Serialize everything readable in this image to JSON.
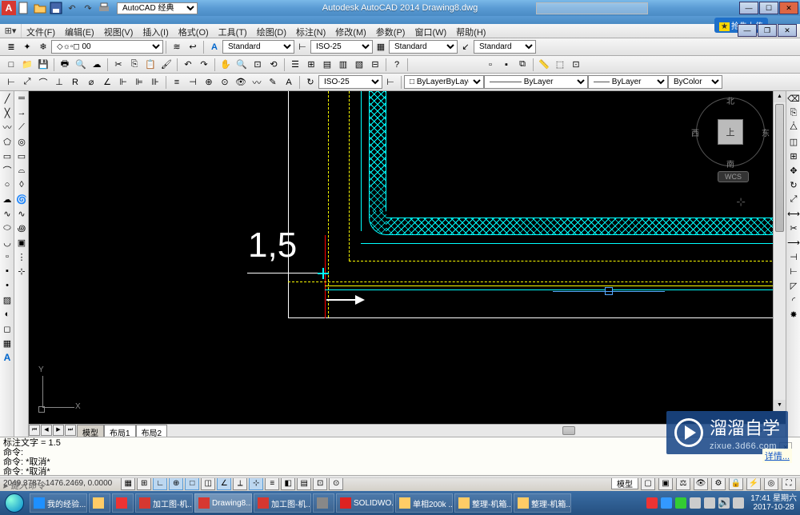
{
  "titlebar": {
    "workspace": "AutoCAD 经典",
    "app_title": "Autodesk AutoCAD 2014    Drawing8.dwg",
    "upload_btn": "抢先上传",
    "qat": {
      "new": "new-document-icon",
      "open": "open-folder-icon",
      "save": "save-disk-icon",
      "undo": "undo-icon",
      "redo": "redo-icon",
      "print": "print-icon"
    }
  },
  "menubar": {
    "items": [
      "文件(F)",
      "编辑(E)",
      "视图(V)",
      "插入(I)",
      "格式(O)",
      "工具(T)",
      "绘图(D)",
      "标注(N)",
      "修改(M)",
      "参数(P)",
      "窗口(W)",
      "帮助(H)"
    ]
  },
  "layer_toolbar": {
    "layer_combo": "0",
    "style1": "Standard",
    "dim_style": "ISO-25",
    "style2": "Standard",
    "style3": "Standard"
  },
  "properties_toolbar": {
    "annotative": "ISO-25",
    "color": "ByLayer",
    "linetype": "ByLayer",
    "lineweight": "ByLayer",
    "plotstyle": "ByColor"
  },
  "drawing": {
    "dim_text": "1,5",
    "axis_x": "X",
    "axis_y": "Y",
    "cube_face": "上",
    "cube_n": "北",
    "cube_s": "南",
    "cube_e": "东",
    "cube_w": "西",
    "wcs": "WCS"
  },
  "model_tabs": {
    "model": "模型",
    "layout1": "布局1",
    "layout2": "布局2"
  },
  "command": {
    "line1": "标注文字 = 1.5",
    "line2": "命令:",
    "line3": "命令: *取消*",
    "line4": "命令: *取消*",
    "prompt": "键入命令"
  },
  "statusbar": {
    "coords": "2049.3787, 1476.2469, 0.0000",
    "model_paper": "模型"
  },
  "watermark": {
    "brand": "溜溜自学",
    "url": "zixue.3d66.com"
  },
  "popup": {
    "link": "详情..."
  },
  "taskbar": {
    "items": [
      "我的经验...",
      "",
      "",
      "加工图-机...",
      "Drawing8...",
      "加工图-机...",
      "",
      "SOLIDWO...",
      "单相200k ...",
      "整理-机箱...",
      "整理-机箱..."
    ]
  },
  "tray": {
    "time": "17:41",
    "day": "星期六",
    "date": "2017-10-28"
  }
}
